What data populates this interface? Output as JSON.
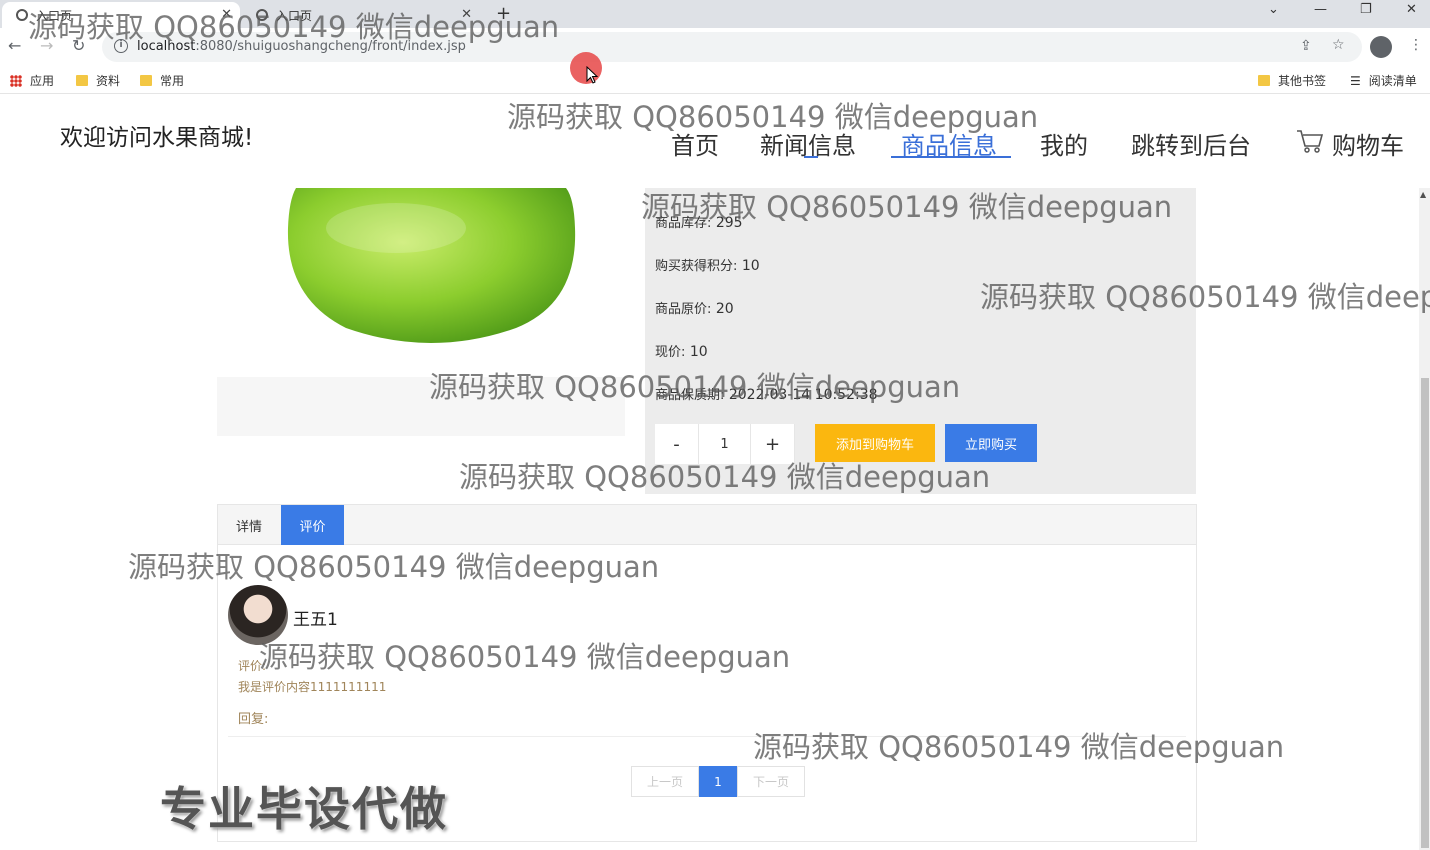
{
  "browser": {
    "tabs": [
      {
        "label": "入口页"
      },
      {
        "label": "入口页"
      }
    ],
    "new_tab": "+",
    "url_host": "localhost",
    "url_rest": ":8080/shuiguoshangcheng/front/index.jsp",
    "bookmarks": [
      {
        "label": "应用"
      },
      {
        "label": "资料"
      },
      {
        "label": "常用"
      }
    ],
    "other_bookmarks": "其他书签",
    "reading_list": "阅读清单"
  },
  "site": {
    "title": "欢迎访问水果商城!",
    "nav": [
      {
        "label": "首页"
      },
      {
        "label": "新闻信息"
      },
      {
        "label": "商品信息",
        "active": true
      },
      {
        "label": "我的"
      },
      {
        "label": "跳转到后台"
      },
      {
        "label": "购物车"
      }
    ]
  },
  "product": {
    "stock_label": "商品库存:",
    "stock_value": "295",
    "points_label": "购买获得积分:",
    "points_value": "10",
    "orig_price_label": "商品原价:",
    "orig_price_value": "20",
    "price_label": "现价:",
    "price_value": "10",
    "expiry_label": "商品保质期:",
    "expiry_value": "2022-03-14 10:52:38",
    "qty_minus": "-",
    "qty_value": "1",
    "qty_plus": "+",
    "add_to_cart": "添加到购物车",
    "buy_now": "立即购买"
  },
  "tabs": {
    "detail": "详情",
    "review": "评价"
  },
  "review": {
    "user": "王五1",
    "label": "评价:",
    "content": "我是评价内容1111111111",
    "reply_label": "回复:"
  },
  "pager": {
    "prev": "上一页",
    "current": "1",
    "next": "下一页"
  },
  "overlay": {
    "watermark": "源码获取 QQ86050149 微信deepguan",
    "promo": "专业毕设代做"
  },
  "colors": {
    "accent": "#3a7be6",
    "cart_button": "#fbb70f"
  }
}
